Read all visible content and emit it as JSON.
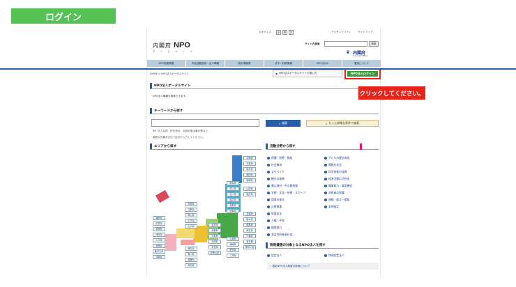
{
  "banner": {
    "title": "ログイン"
  },
  "util_bar": {
    "font_size_label": "文字サイズ",
    "font_buttons": [
      "小",
      "中",
      "大"
    ],
    "links": [
      "アクセシビリティ",
      "サイトマップ"
    ]
  },
  "header": {
    "logo_line1": "内閣府",
    "logo_npo": "NPO",
    "logo_line2": "ホ ー ム ペ ー ジ",
    "site_search_label": "サイト内検索",
    "site_search_button": "検索",
    "cao_name": "内閣府",
    "cao_mark": "❦",
    "cao_sub": "Cabinet Office"
  },
  "nav": {
    "items": [
      "NPO制度概要",
      "市民活動団体・法人情報",
      "統計情報等",
      "法令・判例情報",
      "NPO法QA",
      "運用について"
    ]
  },
  "breadcrumb": "HOME > NPO法人ポータルサイト",
  "help_button": "NPO法人ポータルサイトの使い方",
  "login_button": "NPO法人ログイン",
  "callout": "クリックしてください。",
  "portal": {
    "title": "NPO法人ポータルサイト",
    "description": "NPO法人情報を検索できます。"
  },
  "keyword": {
    "title": "キーワードから探す",
    "search_button": "検索",
    "detail_button": "もっと詳細な条件で検索",
    "note1": "例）法人名称、所在地名、定款記載活動分野など",
    "note2": "複数の言葉を空白で区切り入力してください。"
  },
  "area": {
    "title": "エリアから探す",
    "prefectures": [
      "北海道",
      "青森県",
      "岩手県",
      "秋田県",
      "宮城県",
      "山形県",
      "福島県",
      "新潟県",
      "富山県",
      "石川県",
      "福井県",
      "長野県",
      "岐阜県",
      "茨城県",
      "栃木県",
      "群馬県",
      "埼玉県",
      "千葉県",
      "東京都",
      "神奈川県",
      "山梨県",
      "静岡県",
      "愛知県",
      "三重県",
      "滋賀県",
      "京都府",
      "大阪府",
      "兵庫県",
      "奈良県",
      "和歌山県",
      "鳥取県",
      "島根県",
      "岡山県",
      "広島県",
      "山口県",
      "徳島県",
      "香川県",
      "愛媛県",
      "高知県",
      "福岡県",
      "佐賀県",
      "長崎県",
      "熊本県",
      "大分県",
      "宮崎県",
      "鹿児島県",
      "沖縄県"
    ]
  },
  "activity": {
    "title": "活動分野から探す",
    "left": [
      "保健・医療・福祉",
      "社会教育",
      "まちづくり",
      "観光の振興",
      "農山漁村・中山間地域",
      "学術・文化・芸術・スポーツ",
      "環境の保全",
      "災害救援",
      "地域安全",
      "人権・平和",
      "国際協力",
      "男女共同参画社会"
    ],
    "right": [
      "子どもの健全育成",
      "情報化社会",
      "科学技術の振興",
      "経済活動の活性化",
      "職業能力・雇用機会",
      "消費者の保護",
      "連絡・助言・援助",
      "条例指定"
    ]
  },
  "certified": {
    "title": "税制優遇の対象となるNPO法人を探す",
    "items": [
      "認定法人",
      "特例認定法人"
    ],
    "link": "認定NPO法人制度の詳細について"
  }
}
